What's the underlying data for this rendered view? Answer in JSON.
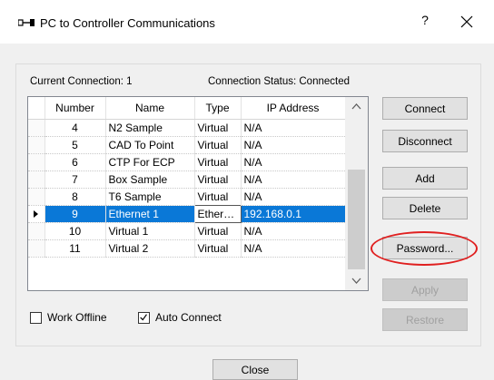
{
  "window": {
    "title": "PC to Controller Communications",
    "help_label": "?"
  },
  "connection": {
    "current_label": "Current Connection: 1",
    "status_label": "Connection Status: Connected"
  },
  "table": {
    "columns": [
      "Number",
      "Name",
      "Type",
      "IP Address"
    ],
    "rows": [
      {
        "number": "4",
        "name": "N2 Sample",
        "type": "Virtual",
        "ip": "N/A"
      },
      {
        "number": "5",
        "name": "CAD To Point",
        "type": "Virtual",
        "ip": "N/A"
      },
      {
        "number": "6",
        "name": "CTP For ECP",
        "type": "Virtual",
        "ip": "N/A"
      },
      {
        "number": "7",
        "name": "Box Sample",
        "type": "Virtual",
        "ip": "N/A"
      },
      {
        "number": "8",
        "name": "T6 Sample",
        "type": "Virtual",
        "ip": "N/A"
      },
      {
        "number": "9",
        "name": "Ethernet 1",
        "type": "Ether…",
        "ip": "192.168.0.1",
        "selected": true
      },
      {
        "number": "10",
        "name": "Virtual 1",
        "type": "Virtual",
        "ip": "N/A"
      },
      {
        "number": "11",
        "name": "Virtual 2",
        "type": "Virtual",
        "ip": "N/A"
      }
    ]
  },
  "buttons": {
    "connect": "Connect",
    "disconnect": "Disconnect",
    "add": "Add",
    "delete": "Delete",
    "password": "Password...",
    "apply": "Apply",
    "restore": "Restore",
    "close": "Close"
  },
  "options": {
    "work_offline": {
      "label": "Work Offline",
      "checked": false
    },
    "auto_connect": {
      "label": "Auto Connect",
      "checked": true
    }
  },
  "colors": {
    "selection": "#0a78d7",
    "highlight_ellipse": "#e02020"
  }
}
